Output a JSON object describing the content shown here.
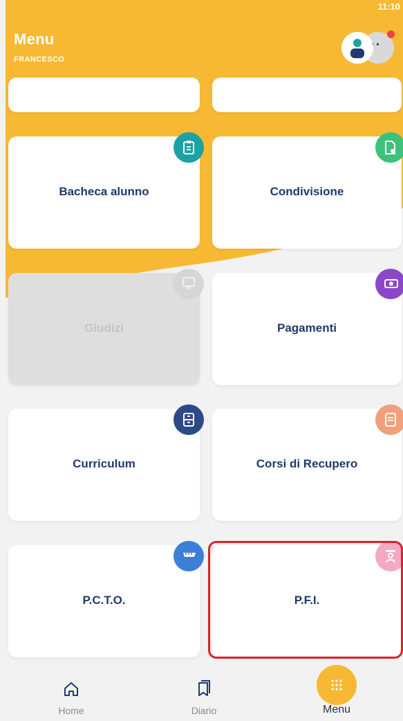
{
  "status": {
    "time": "11:10"
  },
  "header": {
    "title": "Menu",
    "user": "FRANCESCO"
  },
  "colors": {
    "accent": "#f7b833",
    "primary_text": "#1f3a6e",
    "highlight": "#e0202a"
  },
  "tiles": [
    {
      "label": "",
      "icon": "blank",
      "state": "normal"
    },
    {
      "label": "",
      "icon": "blank",
      "state": "normal"
    },
    {
      "label": "Bacheca alunno",
      "icon": "clipboard-icon",
      "color": "#1ba3a3",
      "state": "normal"
    },
    {
      "label": "Condivisione",
      "icon": "shared-document-icon",
      "color": "#3cc27a",
      "state": "normal"
    },
    {
      "label": "Giudizi",
      "icon": "certificate-icon",
      "color": "#d6d6d6",
      "state": "disabled"
    },
    {
      "label": "Pagamenti",
      "icon": "money-icon",
      "color": "#8a48c8",
      "state": "normal"
    },
    {
      "label": "Curriculum",
      "icon": "cabinet-icon",
      "color": "#2b4a86",
      "state": "normal"
    },
    {
      "label": "Corsi di Recupero",
      "icon": "notes-icon",
      "color": "#f0a07a",
      "state": "normal"
    },
    {
      "label": "P.C.T.O.",
      "icon": "ruler-icon",
      "color": "#3d7fd8",
      "state": "normal"
    },
    {
      "label": "P.F.I.",
      "icon": "person-card-icon",
      "color": "#f3a9c4",
      "state": "selected"
    }
  ],
  "nav": {
    "home": "Home",
    "diario": "Diario",
    "menu": "Menu"
  }
}
